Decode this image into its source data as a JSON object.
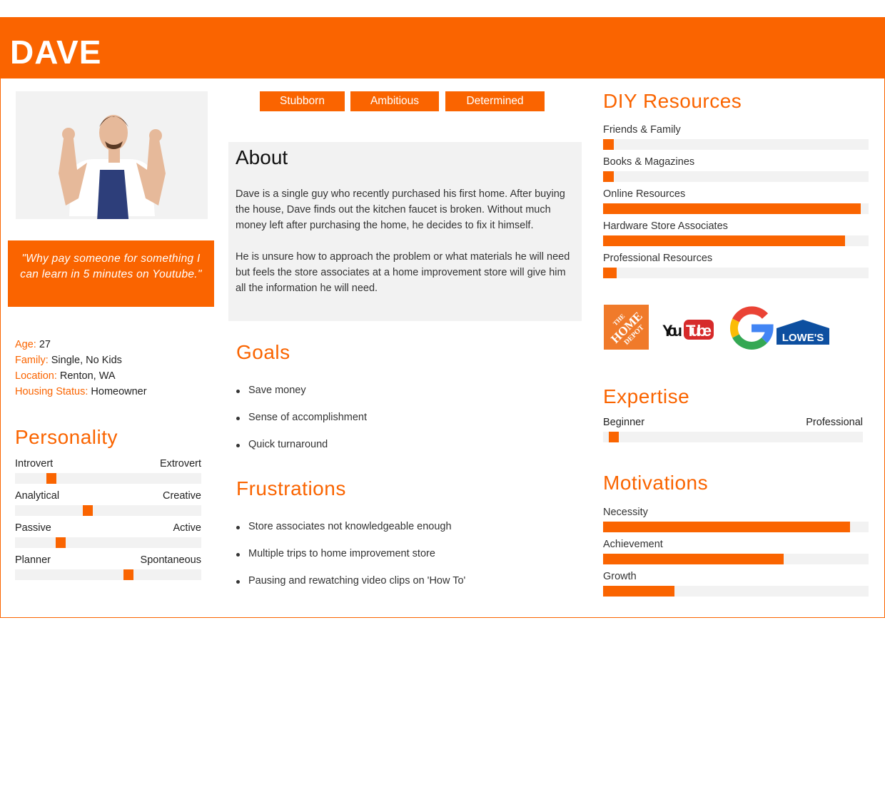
{
  "name": "DAVE",
  "quote": "\"Why pay someone for something I can learn in 5 minutes on Youtube.\"",
  "facts": [
    {
      "k": "Age:",
      "v": " 27"
    },
    {
      "k": "Family:",
      "v": " Single, No Kids"
    },
    {
      "k": "Location:",
      "v": " Renton, WA"
    },
    {
      "k": "Housing Status:",
      "v": " Homeowner"
    }
  ],
  "personality": {
    "title": "Personality",
    "sliders": [
      {
        "left": "Introvert",
        "right": "Extrovert",
        "value": 0.195
      },
      {
        "left": "Analytical",
        "right": "Creative",
        "value": 0.39
      },
      {
        "left": "Passive",
        "right": "Active",
        "value": 0.245
      },
      {
        "left": "Planner",
        "right": "Spontaneous",
        "value": 0.61
      }
    ]
  },
  "traits": [
    "Stubborn",
    "Ambitious",
    "Determined"
  ],
  "about": {
    "title": "About",
    "paragraphs": [
      "Dave is a single guy who recently purchased his first home. After buying the house, Dave finds out the kitchen faucet is broken. Without much money left after purchasing the home, he decides to fix it himself.",
      "He is unsure how to approach the problem or what materials he will need but feels the store associates at a home improvement store will give him all the information he will need."
    ]
  },
  "goals": {
    "title": "Goals",
    "items": [
      "Save money",
      "Sense of accomplishment",
      "Quick turnaround"
    ]
  },
  "frustrations": {
    "title": "Frustrations",
    "items": [
      "Store associates not knowledgeable enough",
      "Multiple trips to home improvement store",
      "Pausing and rewatching video clips on 'How To'"
    ]
  },
  "diy": {
    "title": "DIY Resources",
    "items": [
      {
        "label": "Friends & Family",
        "value": 0.04
      },
      {
        "label": "Books & Magazines",
        "value": 0.04
      },
      {
        "label": "Online Resources",
        "value": 0.97
      },
      {
        "label": "Hardware Store Associates",
        "value": 0.91
      },
      {
        "label": "Professional Resources",
        "value": 0.05
      }
    ]
  },
  "logos": [
    "The Home Depot",
    "YouTube",
    "Google",
    "Lowe's"
  ],
  "expertise": {
    "title": "Expertise",
    "left": "Beginner",
    "right": "Professional",
    "value": 0.04
  },
  "motivations": {
    "title": "Motivations",
    "items": [
      {
        "label": "Necessity",
        "value": 0.93
      },
      {
        "label": "Achievement",
        "value": 0.68
      },
      {
        "label": "Growth",
        "value": 0.27
      }
    ]
  },
  "colors": {
    "accent": "#FA6400",
    "track": "#F2F2F2"
  }
}
